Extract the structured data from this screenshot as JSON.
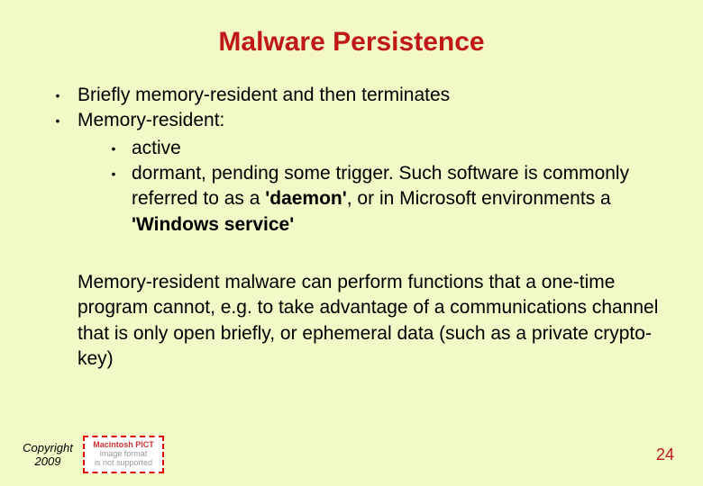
{
  "title": "Malware Persistence",
  "bullets": {
    "b1": "Briefly memory-resident and then terminates",
    "b2": "Memory-resident:",
    "b2a": "active",
    "b2b_pre": "dormant, pending some trigger. Such software is commonly referred to as a ",
    "b2b_bold1": "'daemon'",
    "b2b_mid": ", or in Microsoft environments a ",
    "b2b_bold2": "'Windows service'"
  },
  "paragraph": "Memory-resident malware can perform functions that a one-time program cannot, e.g. to take advantage of a communications channel that is only open briefly, or ephemeral data (such as a private crypto-key)",
  "footer": {
    "copyright_line1": "Copyright",
    "copyright_line2": "2009",
    "missing1": "Macintosh PICT",
    "missing2": "image format",
    "missing3": "is not supported",
    "page_number": "24"
  },
  "glyph": {
    "bullet": "•"
  }
}
